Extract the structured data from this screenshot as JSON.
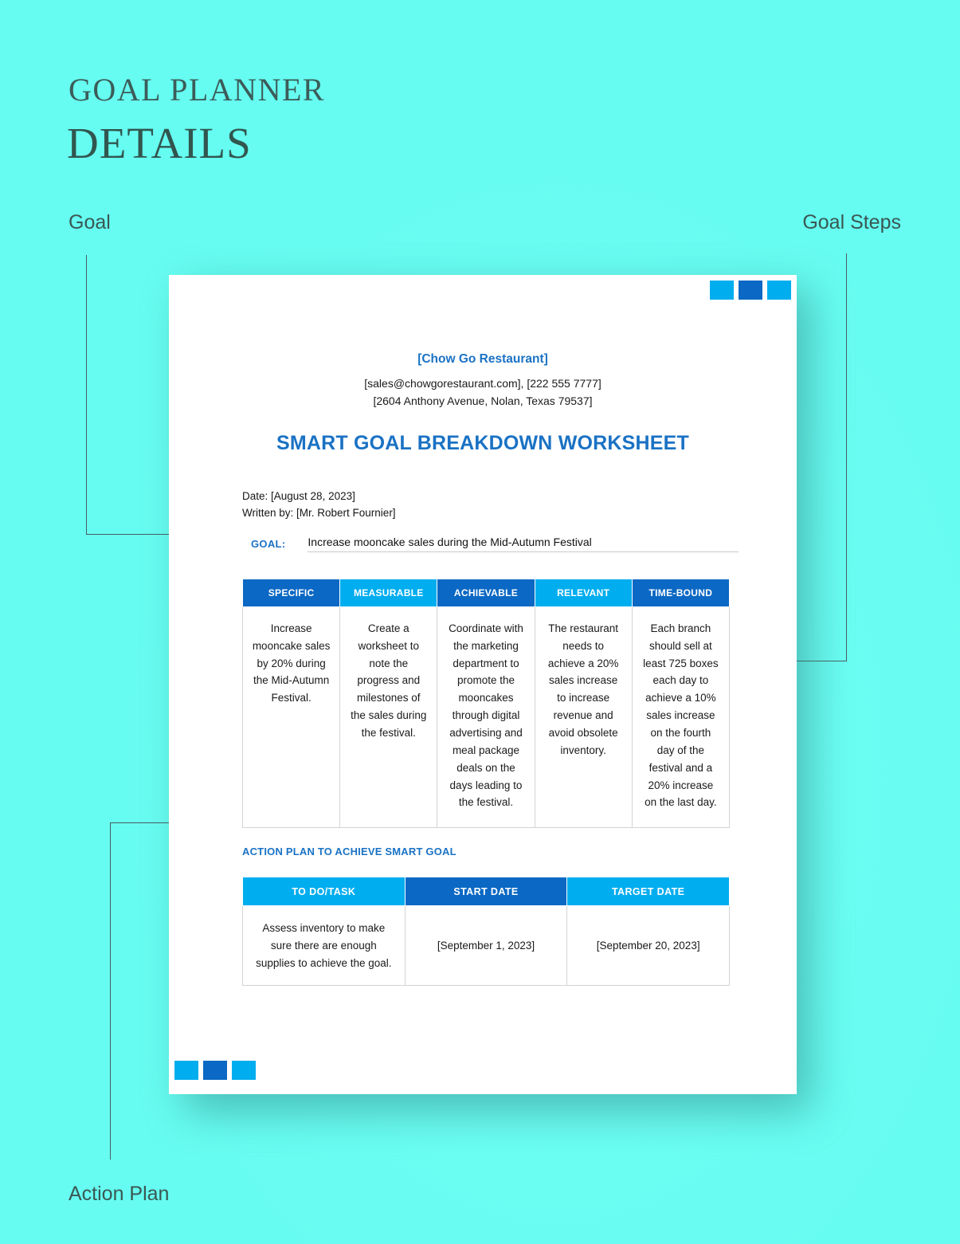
{
  "header": {
    "title_line1": "GOAL PLANNER",
    "title_line2": "DETAILS"
  },
  "callouts": {
    "goal": "Goal",
    "goal_steps": "Goal Steps",
    "action_plan": "Action Plan"
  },
  "document": {
    "company": "[Chow Go Restaurant]",
    "contact_line1": "[sales@chowgorestaurant.com], [222 555 7777]",
    "contact_line2": "[2604 Anthony Avenue, Nolan, Texas 79537]",
    "doc_title": "SMART GOAL BREAKDOWN WORKSHEET",
    "date_line": "Date: [August 28, 2023]",
    "written_by_line": "Written by: [Mr. Robert Fournier]",
    "goal_key": "GOAL:",
    "goal_value": "Increase mooncake sales during the Mid-Autumn Festival",
    "action_plan_heading": "ACTION PLAN TO ACHIEVE SMART GOAL"
  },
  "smart_table": {
    "headers": [
      {
        "label": "SPECIFIC",
        "style": "dark"
      },
      {
        "label": "MEASURABLE",
        "style": "light"
      },
      {
        "label": "ACHIEVABLE",
        "style": "dark"
      },
      {
        "label": "RELEVANT",
        "style": "light"
      },
      {
        "label": "TIME-BOUND",
        "style": "dark"
      }
    ],
    "row": [
      "Increase mooncake sales by 20% during the Mid-Autumn Festival.",
      "Create a worksheet to note the progress and milestones of the sales during the festival.",
      "Coordinate with the marketing department to promote the mooncakes through digital advertising and meal package deals on the days leading to the festival.",
      "The restaurant needs to achieve a 20% sales increase to increase revenue and avoid obsolete inventory.",
      "Each branch should sell at least 725 boxes each day to achieve a 10% sales increase on the fourth day of the festival and a 20% increase on the last day."
    ]
  },
  "action_table": {
    "headers": [
      {
        "label": "TO DO/TASK",
        "style": "light"
      },
      {
        "label": "START DATE",
        "style": "dark"
      },
      {
        "label": "TARGET DATE",
        "style": "light"
      }
    ],
    "rows": [
      [
        "Assess inventory to make sure there are enough supplies to achieve the goal.",
        "[September 1, 2023]",
        "[September 20, 2023]"
      ]
    ]
  },
  "decoration": {
    "squares": [
      "light",
      "dark",
      "light"
    ]
  },
  "colors": {
    "background": "#66FCF1",
    "accent_dark_blue": "#0B68C4",
    "accent_light_blue": "#00ADEF",
    "heading_text": "#3C5C59",
    "doc_blue_text": "#1A72C4"
  }
}
